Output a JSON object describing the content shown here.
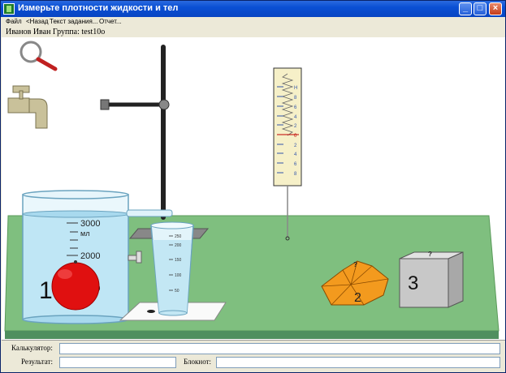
{
  "window": {
    "title": "Измерьте плотности жидкости и тел",
    "controls": {
      "minimize": "_",
      "maximize": "□",
      "close": "×"
    }
  },
  "menu": {
    "items": [
      "Файл",
      "<Назад",
      "Текст задания...",
      "Отчет..."
    ]
  },
  "user": {
    "line": "Иванов Иван  Группа: test10o"
  },
  "scene": {
    "beaker": {
      "ticks": [
        "3000",
        "мл",
        "2000",
        "1000"
      ]
    },
    "ball": {
      "label": "1",
      "color": "#e01010"
    },
    "cylinder": {
      "ticks": [
        "250",
        "200",
        "150",
        "100",
        "50"
      ]
    },
    "dynamometer": {
      "scale": [
        "Н",
        "8",
        "6",
        "4",
        "2",
        "0",
        "2",
        "4",
        "6",
        "8"
      ]
    },
    "body2": {
      "label": "2",
      "color": "#f39a1e",
      "mark": "?"
    },
    "body3": {
      "label": "3",
      "color": "#c8c8c8",
      "mark": "?"
    },
    "colors": {
      "table": "#7fbf7f",
      "water": "#bfe6f5"
    }
  },
  "bottom": {
    "calculator_label": "Калькулятор:",
    "calculator_value": "",
    "result_label": "Результат:",
    "result_value": "",
    "notepad_label": "Блокнот:",
    "notepad_value": ""
  }
}
